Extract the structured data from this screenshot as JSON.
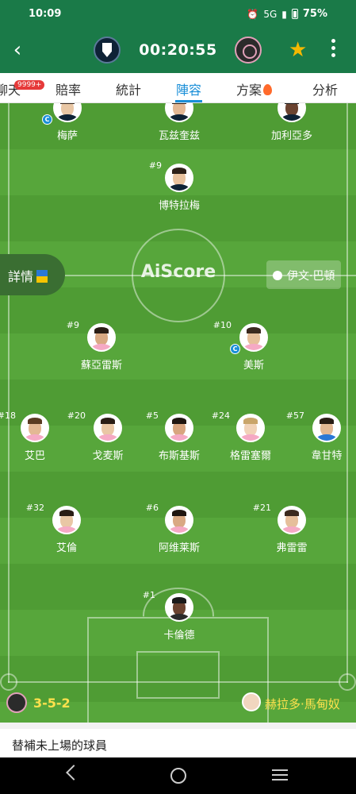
{
  "status_bar": {
    "time": "10:09",
    "network": "5G",
    "battery": "75%"
  },
  "header": {
    "match_time": "00:20:55"
  },
  "tabs": [
    {
      "label": "聊天",
      "badge": "9999+"
    },
    {
      "label": "賠率"
    },
    {
      "label": "統計"
    },
    {
      "label": "陣容",
      "active": true
    },
    {
      "label": "方案",
      "icon": "fire-icon"
    },
    {
      "label": "分析"
    }
  ],
  "pitch": {
    "watermark": "AiScore",
    "details_label": "詳情",
    "referee": "伊文·巴頓"
  },
  "players": [
    {
      "name": "梅萨",
      "number": "",
      "captain": true
    },
    {
      "name": "瓦兹奎兹",
      "number": ""
    },
    {
      "name": "加利亞多",
      "number": ""
    },
    {
      "name": "博特拉梅",
      "number": "#9"
    },
    {
      "name": "蘇亞雷斯",
      "number": "#9"
    },
    {
      "name": "美斯",
      "number": "#10",
      "captain": true
    },
    {
      "name": "艾巴",
      "number": "#18"
    },
    {
      "name": "戈麦斯",
      "number": "#20"
    },
    {
      "name": "布斯基斯",
      "number": "#5"
    },
    {
      "name": "格雷塞爾",
      "number": "#24"
    },
    {
      "name": "韋甘特",
      "number": "#57"
    },
    {
      "name": "艾倫",
      "number": "#32"
    },
    {
      "name": "阿维莱斯",
      "number": "#6"
    },
    {
      "name": "弗雷雷",
      "number": "#21"
    },
    {
      "name": "卡倫德",
      "number": "#1"
    }
  ],
  "captain_mark": "C",
  "formation_bar": {
    "formation": "3-5-2",
    "coach": "赫拉多·馬甸奴"
  },
  "subs_header": "替補未上場的球員",
  "colors": {
    "header": "#1a7a48",
    "accent": "#1a8fd8",
    "pitch": "#4f9c34",
    "highlight": "#ffe14d",
    "badge": "#e63939"
  }
}
